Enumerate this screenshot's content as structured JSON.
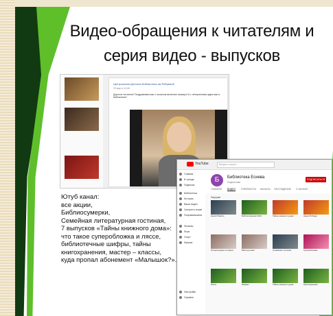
{
  "slide": {
    "title_line1": "Видео-обращения к читателям и",
    "title_line2": "серия видео - выпусков"
  },
  "description": {
    "lines": [
      "Ютуб канал:",
      "все акции,",
      "Библиосумерки,",
      "Семейная литературная гостиная,",
      "7 выпусков «Тайны книжного дома»:",
      "что такое суперобложка и ляссе,",
      "библиотечные шифры, тайны",
      "книгохранения, мастер – классы,",
      "куда пропал абонемент «Малышок?»."
    ]
  },
  "social_post": {
    "author": "Центральная Детская Библиотека им Рябцевой",
    "date": "29 мар в 10:08",
    "text": "Дорогие читатели! Поздравляем вас с началом весенних каникул! А с нетерпением ждем вас в библиотеке!"
  },
  "youtube": {
    "logo": "YouTube",
    "search_placeholder": "Введите запрос",
    "channel_name": "Библиотека Есиева",
    "subscribers": "Подписчики",
    "subscribe_label": "ПОДПИСАТЬСЯ",
    "tabs": [
      "ГЛАВНАЯ",
      "ВИДЕО",
      "ПЛЕЙЛИСТЫ",
      "КАНАЛЫ",
      "ОБСУЖДЕНИЕ",
      "О КАНАЛЕ"
    ],
    "section": "Загрузки",
    "sidebar": [
      "Главная",
      "В тренде",
      "Подписки",
      "Библиотека",
      "История",
      "Ваши видео",
      "Смотреть позже",
      "Понравившиеся",
      "Фильмы",
      "Игры",
      "Спорт",
      "Музыка",
      "Настройки",
      "Справка"
    ],
    "videos": [
      "Акция Память",
      "Библиосумерки 2021",
      "Тайны книжного дома",
      "Акция Победа",
      "Литературная гостиная",
      "Мастер-класс",
      "Семейная гостиная",
      "Суперобложка",
      "Ляссе",
      "Шифры",
      "Тайны книжного дома",
      "Книгохранение",
      "Абонемент Малышок",
      "Мастер-класс",
      "Акция"
    ]
  }
}
